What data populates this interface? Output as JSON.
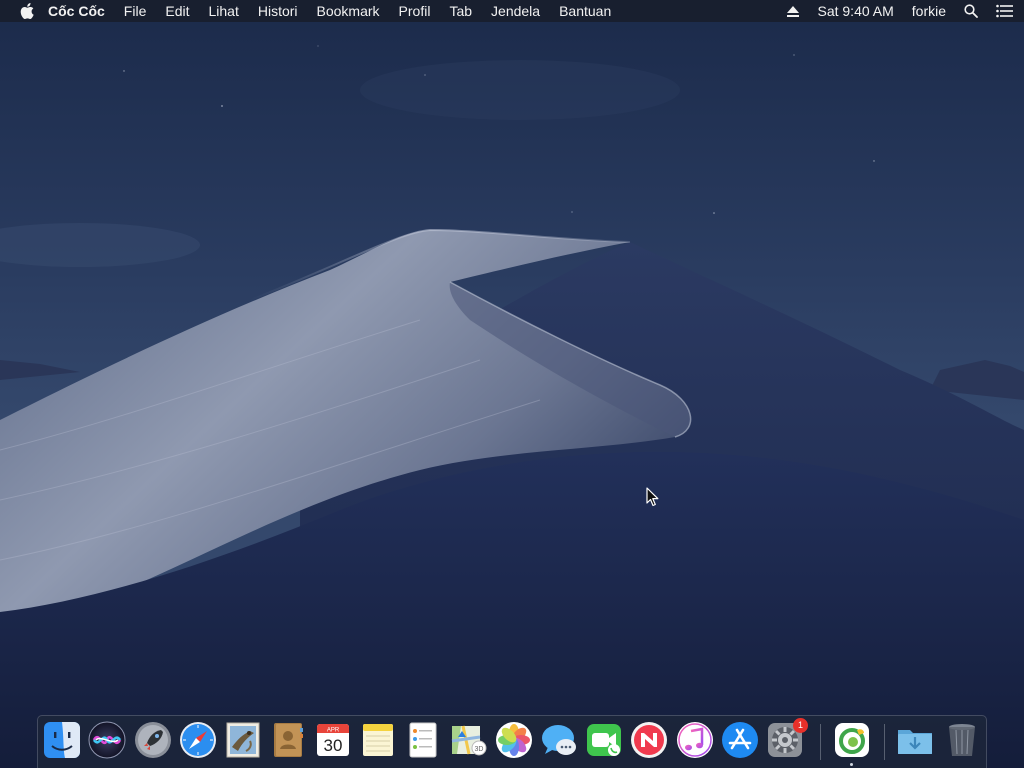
{
  "menubar": {
    "app_name": "Cốc Cốc",
    "items": [
      "File",
      "Edit",
      "Lihat",
      "Histori",
      "Bookmark",
      "Profil",
      "Tab",
      "Jendela",
      "Bantuan"
    ],
    "status": {
      "clock": "Sat 9:40 AM",
      "user": "forkie"
    }
  },
  "dock": {
    "items": [
      {
        "name": "finder",
        "icon": "finder-icon"
      },
      {
        "name": "siri",
        "icon": "siri-icon"
      },
      {
        "name": "launchpad",
        "icon": "launchpad-rocket-icon"
      },
      {
        "name": "safari",
        "icon": "safari-compass-icon"
      },
      {
        "name": "mail",
        "icon": "mail-stamp-icon"
      },
      {
        "name": "contacts",
        "icon": "contacts-book-icon"
      },
      {
        "name": "calendar",
        "icon": "calendar-icon",
        "month": "APR",
        "day": "30"
      },
      {
        "name": "notes",
        "icon": "notes-icon"
      },
      {
        "name": "reminders",
        "icon": "reminders-icon"
      },
      {
        "name": "maps",
        "icon": "maps-icon"
      },
      {
        "name": "photos",
        "icon": "photos-flower-icon"
      },
      {
        "name": "messages",
        "icon": "messages-bubble-icon"
      },
      {
        "name": "facetime",
        "icon": "facetime-camera-icon"
      },
      {
        "name": "news",
        "icon": "news-icon"
      },
      {
        "name": "itunes",
        "icon": "itunes-note-icon"
      },
      {
        "name": "app-store",
        "icon": "app-store-icon"
      },
      {
        "name": "system-preferences",
        "icon": "gear-icon",
        "badge": "1"
      },
      {
        "name": "coc-coc",
        "icon": "coc-coc-browser-icon",
        "running": true
      },
      {
        "name": "downloads",
        "icon": "downloads-folder-icon"
      },
      {
        "name": "trash",
        "icon": "trash-icon"
      }
    ]
  },
  "colors": {
    "menubar_bg": "#181e2c",
    "sky_top": "#1c2a4a",
    "sky_mid": "#2f4265",
    "dune_light": "#9aa3b8",
    "dune_dark": "#1a2547",
    "badge": "#e8302a"
  }
}
